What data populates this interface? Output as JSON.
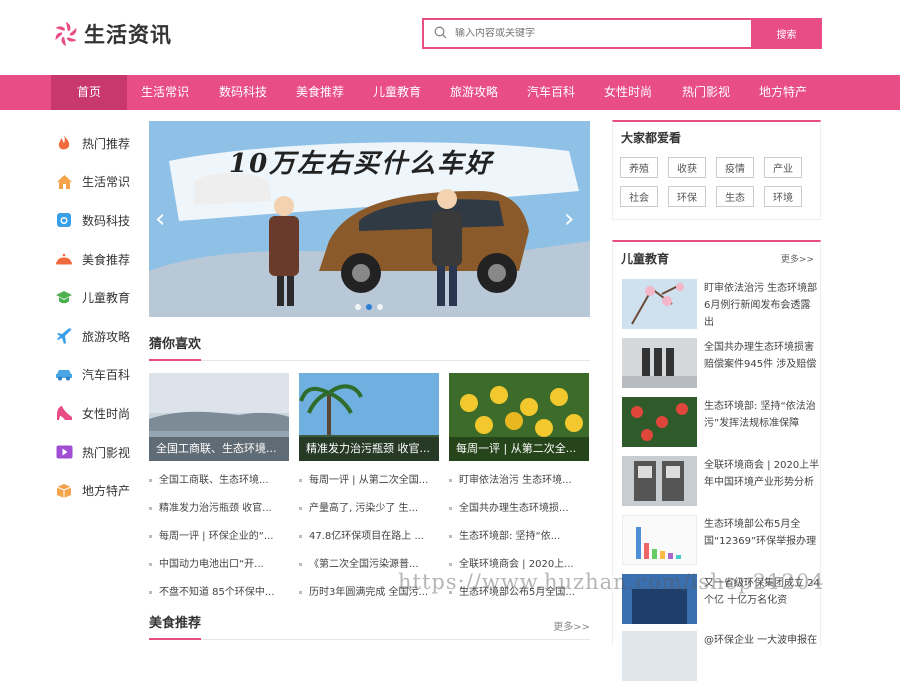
{
  "brand": {
    "name": "生活资讯",
    "accent": "#e84d85"
  },
  "search": {
    "placeholder": "输入内容或关键字",
    "button": "搜索"
  },
  "nav": [
    "首页",
    "生活常识",
    "数码科技",
    "美食推荐",
    "儿童教育",
    "旅游攻略",
    "汽车百科",
    "女性时尚",
    "热门影视",
    "地方特产"
  ],
  "left_menu": [
    {
      "icon": "fire-icon",
      "label": "热门推荐"
    },
    {
      "icon": "home-icon",
      "label": "生活常识"
    },
    {
      "icon": "camera-icon",
      "label": "数码科技"
    },
    {
      "icon": "food-icon",
      "label": "美食推荐"
    },
    {
      "icon": "graduation-cap-icon",
      "label": "儿童教育"
    },
    {
      "icon": "plane-icon",
      "label": "旅游攻略"
    },
    {
      "icon": "car-icon",
      "label": "汽车百科"
    },
    {
      "icon": "high-heel-icon",
      "label": "女性时尚"
    },
    {
      "icon": "play-icon",
      "label": "热门影视"
    },
    {
      "icon": "box-icon",
      "label": "地方特产"
    }
  ],
  "banner": {
    "title": "10万左右买什么车好"
  },
  "guess": {
    "title": "猜你喜欢",
    "cards": [
      "全国工商联、生态环境...",
      "精准发力治污瓶颈 收官...",
      "每周一评 | 从第二次全..."
    ],
    "columns": [
      [
        "全国工商联、生态环境...",
        "精准发力治污瓶颈 收官...",
        "每周一评 | 环保企业的“...",
        "中国动力电池出口“开...",
        "不盘不知道 85个环保中..."
      ],
      [
        "每周一评 | 从第二次全国...",
        "产量高了, 污染少了 生...",
        "47.8亿环保项目在路上 ...",
        "《第二次全国污染源普...",
        "历时3年圆满完成 全国污..."
      ],
      [
        "盯审依法治污 生态环境...",
        "全国共办理生态环境损...",
        "生态环境部: 坚持“依...",
        "全联环境商会 | 2020上...",
        "生态环境部公布5月全国..."
      ]
    ]
  },
  "food": {
    "title": "美食推荐",
    "more": "更多>>"
  },
  "popular": {
    "title": "大家都爱看",
    "tags": [
      "养殖",
      "收获",
      "疫情",
      "产业",
      "社会",
      "环保",
      "生态",
      "环境"
    ]
  },
  "kids": {
    "title": "儿童教育",
    "more": "更多>>",
    "items": [
      "盯审依法治污 生态环境部6月例行新闻发布会透露出",
      "全国共办理生态环境损害赔偿案件945件 涉及赔偿",
      "生态环境部: 坚持“依法治污”发挥法规标准保障",
      "全联环境商会 | 2020上半年中国环境产业形势分析",
      "生态环境部公布5月全国“12369”环保举报办理",
      "又一省级环保集团成立 24 个亿 十亿万名化资",
      "@环保企业 一大波申报在"
    ]
  },
  "watermark": "https://www.huzhan.com/ishop21204"
}
